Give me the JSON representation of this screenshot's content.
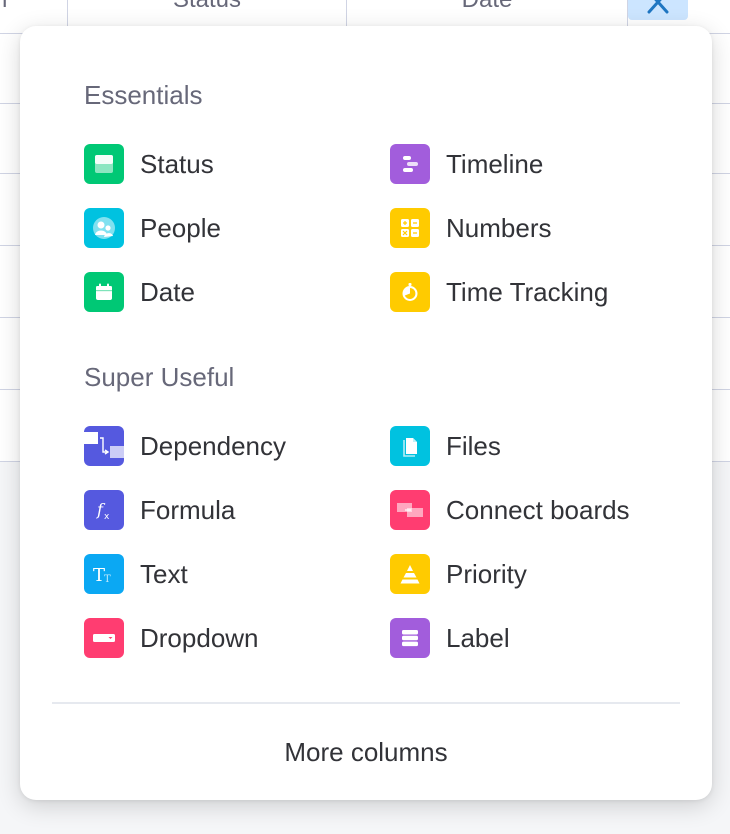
{
  "board": {
    "columns": [
      "Status",
      "Date"
    ],
    "close_icon": "close-icon"
  },
  "popup": {
    "sections": [
      {
        "title": "Essentials",
        "items": [
          {
            "label": "Status",
            "icon": "status-icon",
            "color": "#00c875"
          },
          {
            "label": "Timeline",
            "icon": "timeline-icon",
            "color": "#a25ddc"
          },
          {
            "label": "People",
            "icon": "people-icon",
            "color": "#00c2e0"
          },
          {
            "label": "Numbers",
            "icon": "numbers-icon",
            "color": "#ffcb00"
          },
          {
            "label": "Date",
            "icon": "date-icon",
            "color": "#00c875"
          },
          {
            "label": "Time Tracking",
            "icon": "time-tracking-icon",
            "color": "#ffcb00"
          }
        ]
      },
      {
        "title": "Super Useful",
        "items": [
          {
            "label": "Dependency",
            "icon": "dependency-icon",
            "color": "#5559df"
          },
          {
            "label": "Files",
            "icon": "files-icon",
            "color": "#00c2e0"
          },
          {
            "label": "Formula",
            "icon": "formula-icon",
            "color": "#5559df"
          },
          {
            "label": "Connect boards",
            "icon": "connect-boards-icon",
            "color": "#ff5ac4"
          },
          {
            "label": "Text",
            "icon": "text-icon",
            "color": "#0ba8f3"
          },
          {
            "label": "Priority",
            "icon": "priority-icon",
            "color": "#ffcb00"
          },
          {
            "label": "Dropdown",
            "icon": "dropdown-icon",
            "color": "#ff3d71"
          },
          {
            "label": "Label",
            "icon": "label-icon",
            "color": "#a25ddc"
          }
        ]
      }
    ],
    "more_label": "More columns"
  }
}
